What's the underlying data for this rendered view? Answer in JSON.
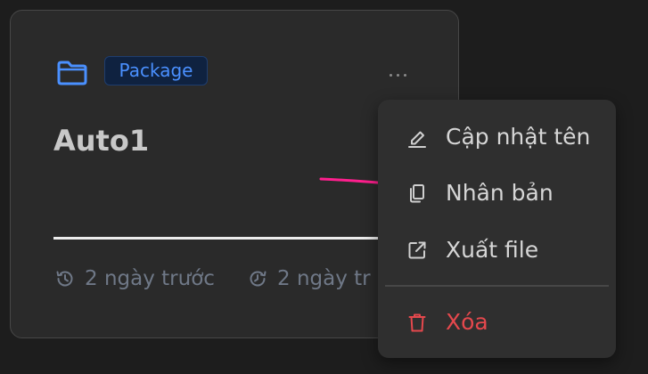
{
  "card": {
    "badge": "Package",
    "title": "Auto1",
    "created": "2 ngày trước",
    "updated": "2 ngày tr",
    "progress": 1.0
  },
  "menu": {
    "items": [
      {
        "label": "Cập nhật tên",
        "icon": "pencil-icon"
      },
      {
        "label": "Nhân bản",
        "icon": "copy-icon"
      },
      {
        "label": "Xuất file",
        "icon": "external-link-icon"
      },
      {
        "label": "Xóa",
        "icon": "trash-icon"
      }
    ]
  },
  "colors": {
    "background": "#1d1d1d",
    "card": "#2a2a2a",
    "menu": "#2f2f2f",
    "accent": "#4a90ff",
    "danger": "#e5484d",
    "arrow": "#ff1f8e"
  }
}
